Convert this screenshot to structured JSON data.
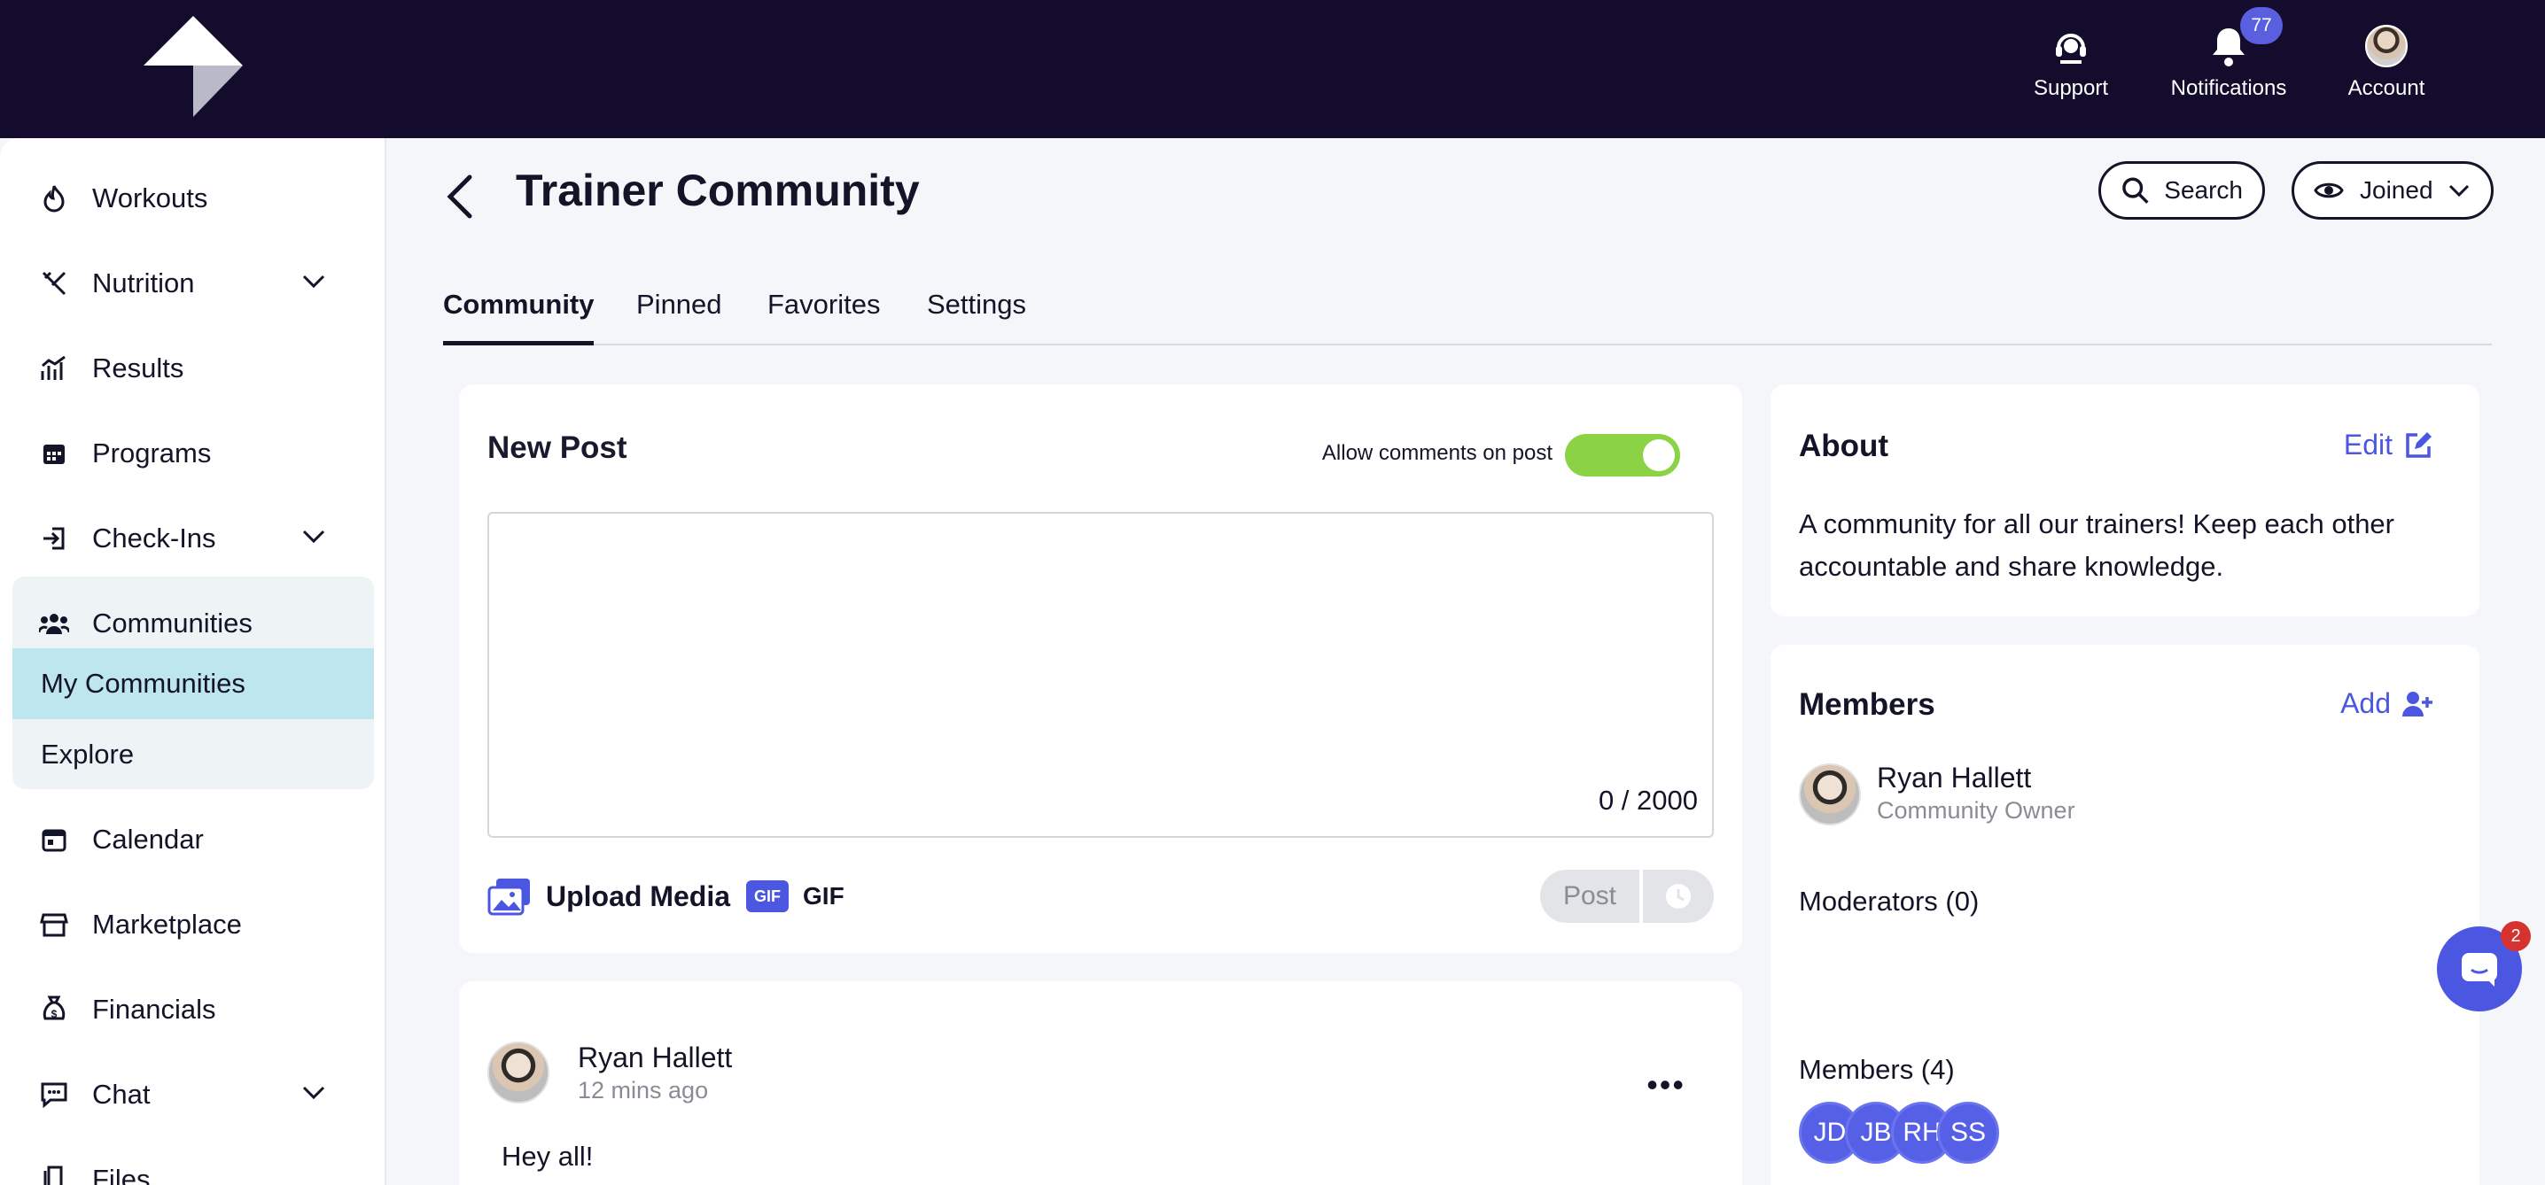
{
  "topbar": {
    "support_label": "Support",
    "notifications_label": "Notifications",
    "notifications_count": "77",
    "account_label": "Account"
  },
  "sidebar": {
    "items": [
      {
        "label": "Workouts"
      },
      {
        "label": "Nutrition"
      },
      {
        "label": "Results"
      },
      {
        "label": "Programs"
      },
      {
        "label": "Check-Ins"
      },
      {
        "label": "Communities"
      },
      {
        "label": "Calendar"
      },
      {
        "label": "Marketplace"
      },
      {
        "label": "Financials"
      },
      {
        "label": "Chat"
      },
      {
        "label": "Files"
      }
    ],
    "communities_sub": [
      {
        "label": "My Communities"
      },
      {
        "label": "Explore"
      }
    ]
  },
  "header": {
    "title": "Trainer Community",
    "search_label": "Search",
    "joined_label": "Joined"
  },
  "tabs": [
    {
      "label": "Community"
    },
    {
      "label": "Pinned"
    },
    {
      "label": "Favorites"
    },
    {
      "label": "Settings"
    }
  ],
  "new_post": {
    "title": "New Post",
    "allow_comments_label": "Allow comments on post",
    "counter": "0 / 2000",
    "upload_label": "Upload Media",
    "gif_badge": "GIF",
    "gif_label": "GIF",
    "post_label": "Post"
  },
  "post": {
    "author": "Ryan Hallett",
    "time": "12 mins ago",
    "body": "Hey all!"
  },
  "about": {
    "title": "About",
    "edit_label": "Edit",
    "text": "A community for all our trainers! Keep each other accountable and share knowledge."
  },
  "members": {
    "title": "Members",
    "add_label": "Add",
    "owner_name": "Ryan Hallett",
    "owner_role": "Community Owner",
    "moderators_label": "Moderators (0)",
    "members_label": "Members (4)",
    "initials": [
      "JD",
      "JB",
      "RH",
      "SS"
    ]
  },
  "chat_widget": {
    "badge": "2"
  }
}
